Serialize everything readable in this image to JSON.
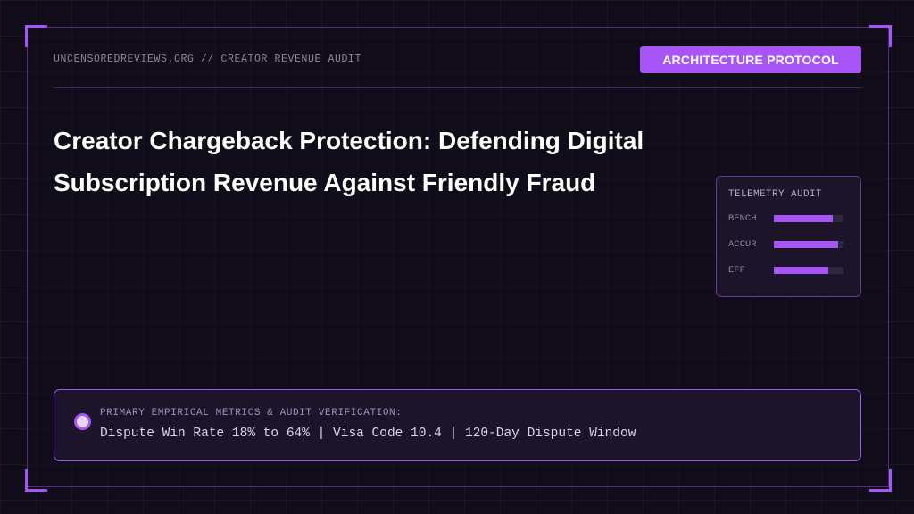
{
  "header": {
    "site_label": "UNCENSOREDREVIEWS.ORG // CREATOR REVENUE AUDIT",
    "badge": "ARCHITECTURE PROTOCOL"
  },
  "title": "Creator Chargeback Protection: Defending Digital Subscription Revenue Against Friendly Fraud",
  "telemetry": {
    "title": "TELEMETRY AUDIT",
    "rows": [
      {
        "label": "BENCH",
        "fill": 0.85
      },
      {
        "label": "ACCUR",
        "fill": 0.92
      },
      {
        "label": "EFF",
        "fill": 0.78
      }
    ]
  },
  "metrics": {
    "heading": "PRIMARY EMPIRICAL METRICS & AUDIT VERIFICATION:",
    "values": "Dispute Win Rate 18% to 64% | Visa Code 10.4 | 120-Day Dispute Window"
  },
  "colors": {
    "accent": "#a855f7",
    "background": "#110c1a",
    "panel": "#1c1529"
  }
}
